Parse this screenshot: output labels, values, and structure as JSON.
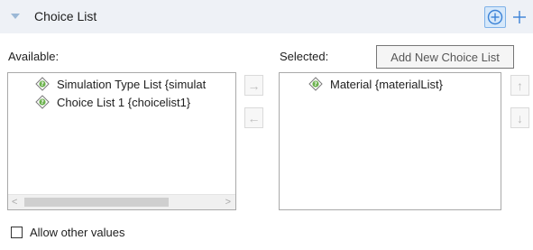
{
  "section": {
    "title": "Choice List",
    "add_new_icon": "circle-plus-icon",
    "add_icon": "plus-icon"
  },
  "available": {
    "label": "Available:",
    "items": [
      {
        "text": "Simulation Type List {simulat",
        "icon": "choice-list-icon"
      },
      {
        "text": "Choice List 1 {choicelist1}",
        "icon": "choice-list-icon"
      }
    ]
  },
  "selected": {
    "label": "Selected:",
    "items": [
      {
        "text": "Material {materialList}",
        "icon": "choice-list-icon"
      }
    ]
  },
  "move_buttons": {
    "move_right": "→",
    "move_left": "←",
    "move_up": "↑",
    "move_down": "↓"
  },
  "allow_other_values": {
    "label": "Allow other values",
    "checked": false
  },
  "tooltip": {
    "text": "Add New Choice List"
  },
  "colors": {
    "header_bg": "#eef1f6",
    "accent_blue": "#4a8fdc",
    "icon_green": "#6ab04c"
  }
}
